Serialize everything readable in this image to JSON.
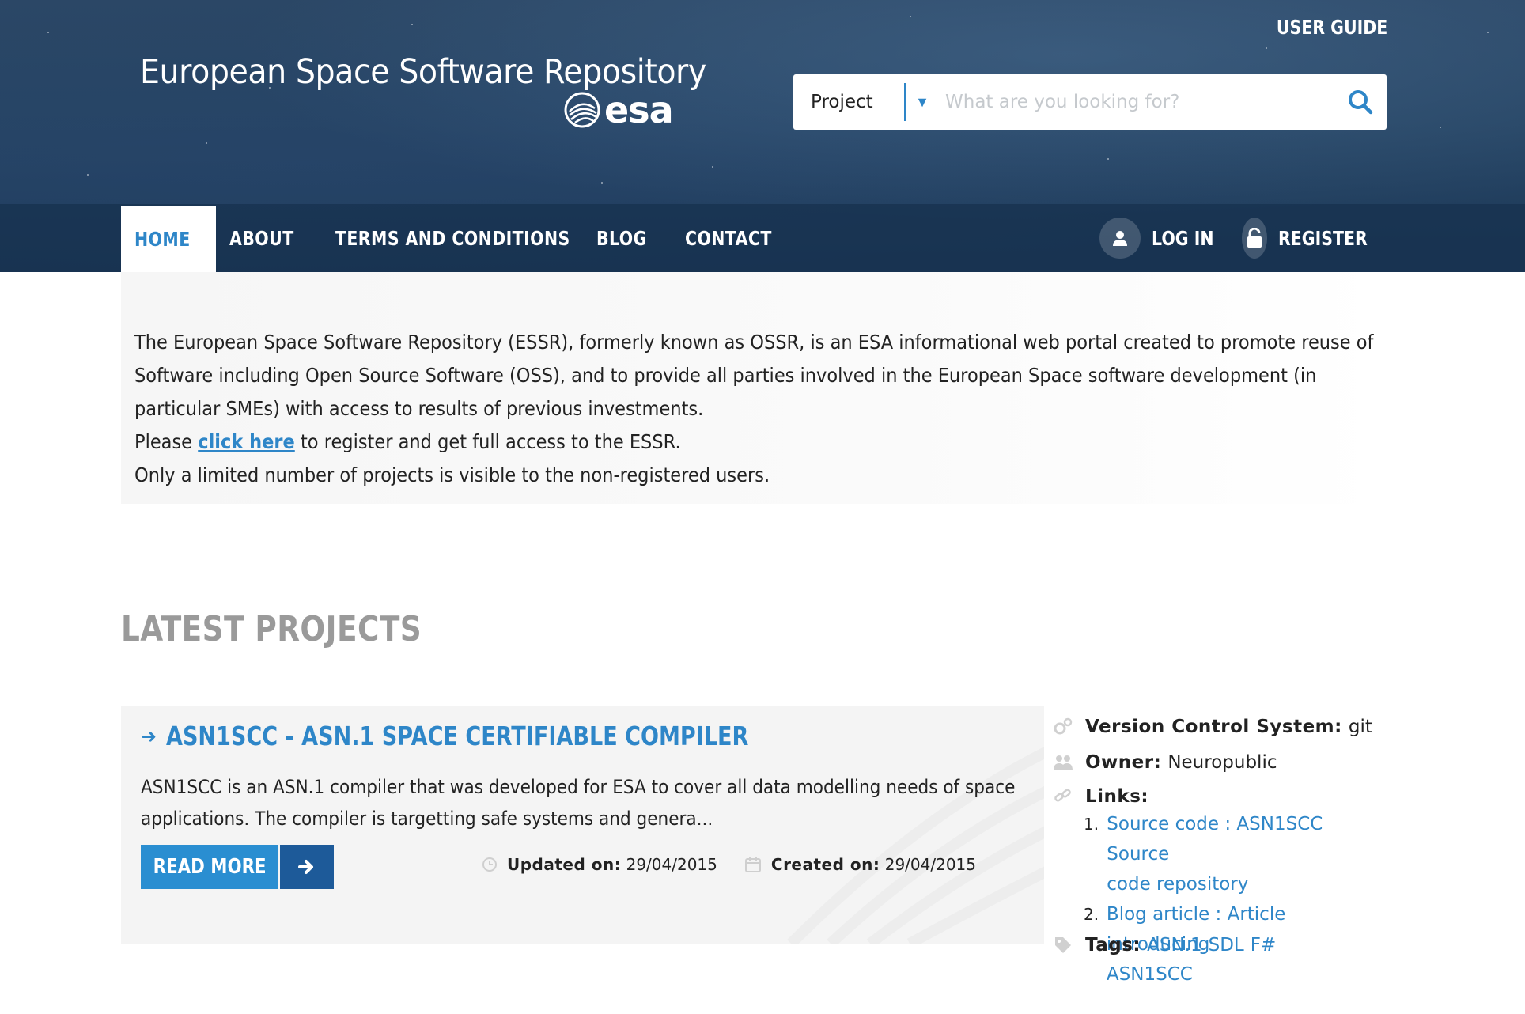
{
  "header": {
    "user_guide": "USER GUIDE",
    "site_title": "European Space Software Repository",
    "logo_text": "esa",
    "search": {
      "category": "Project",
      "placeholder": "What are you looking for?"
    }
  },
  "nav": {
    "items": [
      {
        "label": "HOME",
        "active": true
      },
      {
        "label": "ABOUT",
        "active": false
      },
      {
        "label": "TERMS AND CONDITIONS",
        "active": false
      },
      {
        "label": "BLOG",
        "active": false
      },
      {
        "label": "CONTACT",
        "active": false
      }
    ],
    "login": "LOG IN",
    "register": "REGISTER"
  },
  "intro": {
    "line1": "The European Space Software Repository (ESSR), formerly known as OSSR, is an ESA informational web portal created to promote reuse of",
    "line2": "Software including Open Source Software (OSS), and to provide all parties involved in the European Space software development (in",
    "line3": "particular SMEs) with access to results of previous investments.",
    "please": "Please",
    "click_here": "click here",
    "register_text": "to register and get full access to the ESSR.",
    "limited": "Only a limited number of projects is visible to the non-registered users."
  },
  "latest": {
    "title": "LATEST PROJECTS",
    "project": {
      "title": "ASN1SCC - ASN.1 SPACE CERTIFIABLE COMPILER",
      "desc_line1": "ASN1SCC is an ASN.1 compiler that was developed for ESA to cover all data modelling needs of space",
      "desc_line2": "applications. The compiler is targetting safe systems and genera...",
      "read_more": "READ MORE",
      "updated_label": "Updated on:",
      "updated_value": "29/04/2015",
      "created_label": "Created on:",
      "created_value": "29/04/2015",
      "vcs_label": "Version Control System:",
      "vcs_value": "git",
      "owner_label": "Owner:",
      "owner_value": "Neuropublic",
      "links_label": "Links:",
      "links": [
        {
          "num": "1.",
          "line1": "Source code : ASN1SCC Source",
          "line2": "code repository"
        },
        {
          "num": "2.",
          "line1": "Blog article : Article introducing",
          "line2": "ASN1SCC"
        }
      ],
      "tags_label": "Tags:",
      "tags": [
        "ASN.1",
        "SDL",
        "F#"
      ]
    }
  },
  "colors": {
    "accent": "#2e86c8",
    "header_bg": "#264463",
    "read_more_bg": "#2a8ed1",
    "read_more_arrow_bg": "#1d5a99",
    "section_title": "#9a9a9a"
  }
}
